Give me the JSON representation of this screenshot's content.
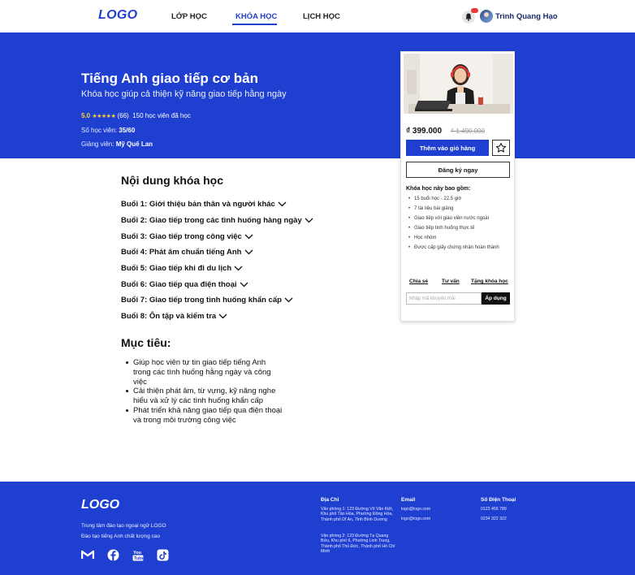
{
  "header": {
    "logo": "LOGO",
    "nav": [
      "LỚP HỌC",
      "KHÓA HỌC",
      "LỊCH HỌC"
    ],
    "active_nav": "KHÓA HỌC",
    "username": "Trình Quang Hạo"
  },
  "hero": {
    "title": "Tiếng Anh giao tiếp cơ bản",
    "subtitle": "Khóa học giúp cả thiện kỹ năng giao tiếp hằng ngày",
    "rating": "5.0",
    "stars": "★★★★★",
    "reviews": "(66)",
    "students_enrolled": "150 học viên đã học",
    "seats_label": "Số học viên:",
    "seats_value": "35/60",
    "instructor_label": "Giảng viên:",
    "instructor_value": "Mỹ Quế Lan"
  },
  "card": {
    "price": "₫ 399.000",
    "old_price": "₫ 1.490.000",
    "add_to_cart": "Thêm vào giỏ hàng",
    "register": "Đăng ký ngay",
    "includes_title": "Khóa học này bao gồm:",
    "includes": [
      "15 buổi học - 22.5 giờ",
      "7 tài liệu bài giảng",
      "Giao tiếp với giáo viên nước ngoài",
      "Giao tiếp tình huống thực tế",
      "Học nhóm",
      "Được cấp giấy chứng nhận hoàn thành"
    ],
    "share": "Chia sẻ",
    "consult": "Tư vấn",
    "gift": "Tặng khóa học",
    "coupon_placeholder": "Nhập mã khuyến mãi",
    "apply": "Áp dụng"
  },
  "content": {
    "title": "Nội dung khóa học",
    "lessons": [
      "Buổi 1: Giới thiệu bản thân và người khác",
      "Buổi 2: Giao tiếp trong các tình huống hàng ngày",
      "Buổi 3: Giao tiếp trong công việc",
      "Buổi 4: Phát âm chuẩn tiếng Anh",
      "Buổi 5: Giao tiếp khi đi du lịch",
      "Buổi 6: Giao tiếp qua điện thoại",
      "Buổi 7: Giao tiếp trong tình huống khẩn cấp",
      "Buổi 8: Ôn tập và kiểm tra"
    ],
    "goals_title": "Mục tiêu:",
    "goals": [
      "Giúp học viên tự tin giao tiếp tiếng Anh trong các tình huống hằng ngày và công việc",
      "Cải thiện phát âm, từ vựng, kỹ năng nghe hiểu và xử lý các tình huống khẩn cấp",
      "Phát triển khả năng giao tiếp qua điện thoại và trong môi trường công việc"
    ]
  },
  "footer": {
    "logo": "LOGO",
    "tagline1": "Trung tâm đào tạo ngoại ngữ LOGO",
    "tagline2": "Đào tạo tiếng Anh chất lượng cao",
    "address_title": "Địa Chỉ",
    "address1": "Văn phòng 1: 123 Đường Võ Văn Kiệt, Khu phố Tân Hòa, Phường Đông Hòa, Thành phố Dĩ An, Tỉnh Bình Dương",
    "address2": "Văn phòng 2: 123 Đường Tạ Quang Bửu, Khu phố 6, Phường Linh Trung, Thành phố Thủ Đức, Thành phố Hồ Chí Minh",
    "email_title": "Email",
    "emails": [
      "logo@logo.com",
      "logo@logo.com"
    ],
    "phone_title": "Số Điện Thoại",
    "phones": [
      "0123 456 789",
      "0234 322 322"
    ],
    "social_icons": [
      "gmail-icon",
      "facebook-icon",
      "youtube-icon",
      "tiktok-icon"
    ]
  }
}
